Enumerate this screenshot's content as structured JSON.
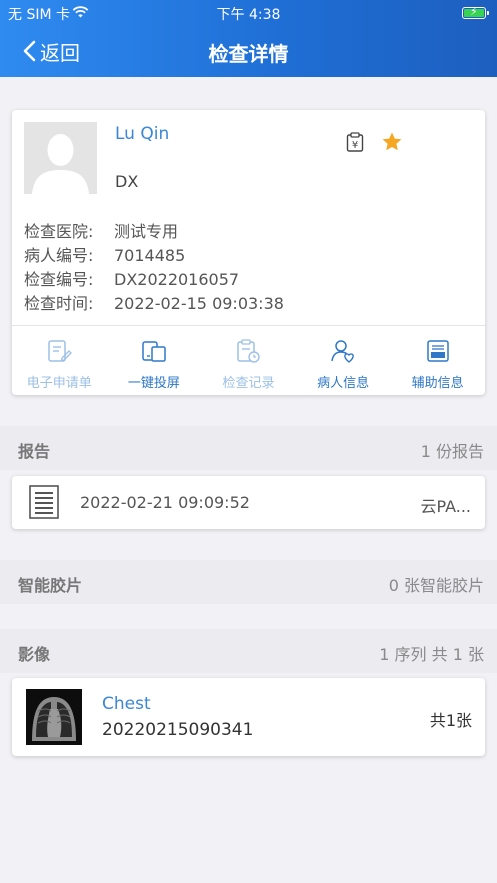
{
  "status_bar": {
    "carrier": "无 SIM 卡",
    "time": "下午 4:38"
  },
  "nav": {
    "back_label": "返回",
    "title": "检查详情"
  },
  "patient": {
    "name": "Lu Qin",
    "modality": "DX",
    "fields": [
      {
        "label": "检查医院:",
        "value": "测试专用"
      },
      {
        "label": "病人编号:",
        "value": "7014485"
      },
      {
        "label": "检查编号:",
        "value": "DX2022016057"
      },
      {
        "label": "检查时间:",
        "value": "2022-02-15 09:03:38"
      }
    ]
  },
  "actions": [
    {
      "label": "电子申请单",
      "icon": "application-form-icon",
      "enabled": false
    },
    {
      "label": "一键投屏",
      "icon": "screen-cast-icon",
      "enabled": true
    },
    {
      "label": "检查记录",
      "icon": "exam-record-icon",
      "enabled": false
    },
    {
      "label": "病人信息",
      "icon": "patient-info-icon",
      "enabled": true
    },
    {
      "label": "辅助信息",
      "icon": "auxiliary-info-icon",
      "enabled": true
    }
  ],
  "reports_section": {
    "title": "报告",
    "count": "1 份报告"
  },
  "report": {
    "time": "2022-02-21 09:09:52",
    "source": "云PA..."
  },
  "film_section": {
    "title": "智能胶片",
    "count": "0 张智能胶片"
  },
  "images_section": {
    "title": "影像",
    "count": "1 序列 共 1 张"
  },
  "series": {
    "name": "Chest",
    "id": "20220215090341",
    "count": "共1张"
  },
  "colors": {
    "header": "#1f6fd6",
    "link": "#3b86d6",
    "star": "#f5a623"
  }
}
